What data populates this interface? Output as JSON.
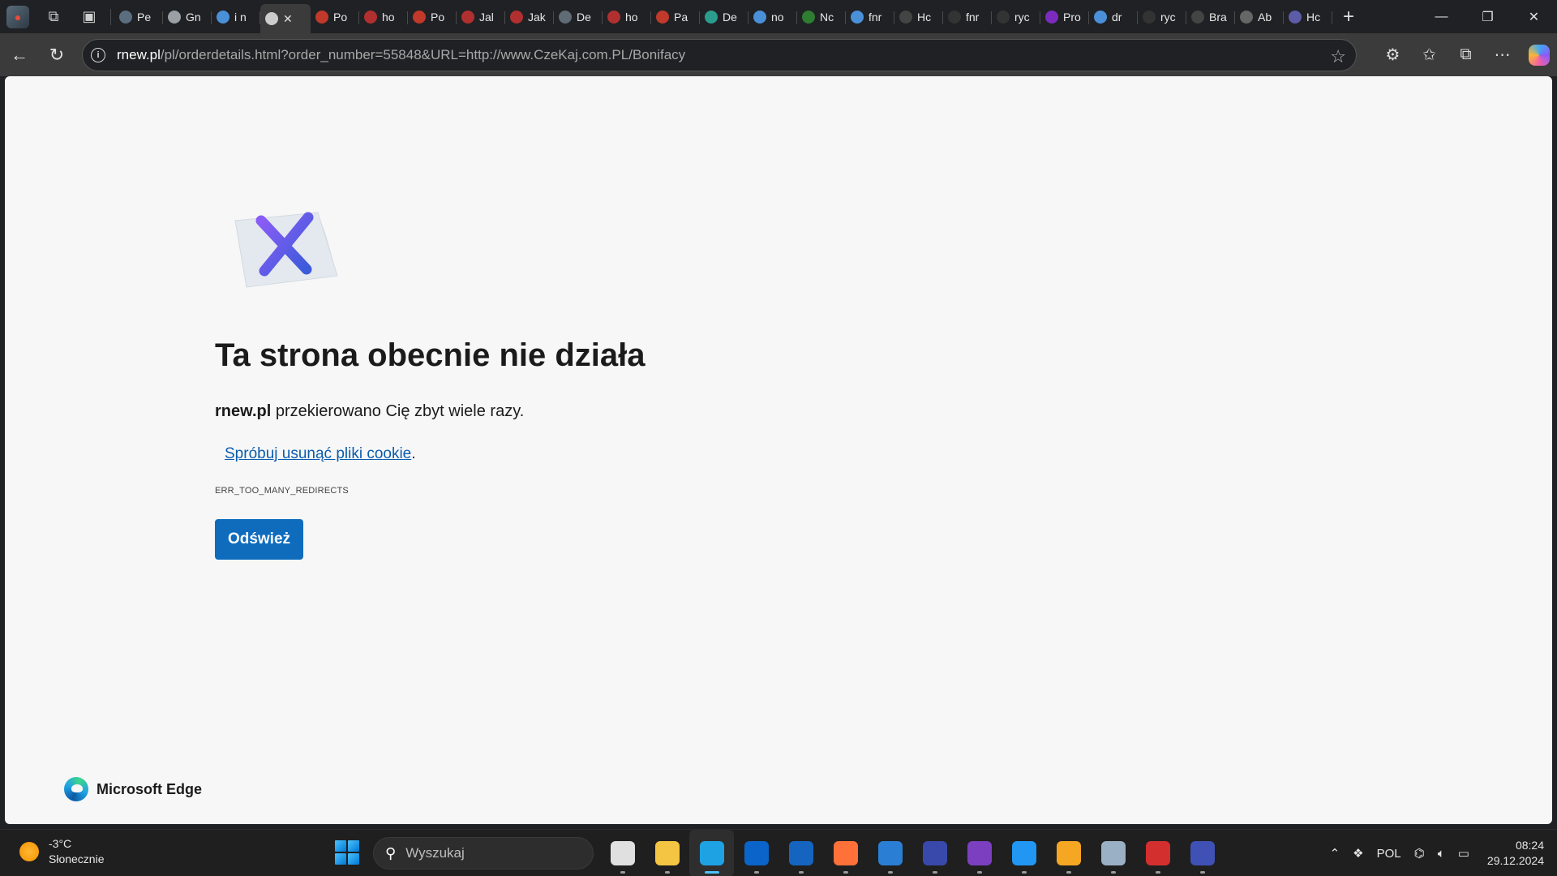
{
  "browser": {
    "tabs": [
      {
        "title": "Pe",
        "color": "#5a6e80"
      },
      {
        "title": "Gn",
        "color": "#9aa0a6"
      },
      {
        "title": "i n",
        "color": "#4a90d9",
        "active": false
      },
      {
        "title": "",
        "color": "#cccccc",
        "active": true
      },
      {
        "title": "Po",
        "color": "#c0392b"
      },
      {
        "title": "ho",
        "color": "#b03030"
      },
      {
        "title": "Po",
        "color": "#c0392b"
      },
      {
        "title": "Jal",
        "color": "#b03030"
      },
      {
        "title": "Jak",
        "color": "#b03030"
      },
      {
        "title": "De",
        "color": "#5f6b75"
      },
      {
        "title": "ho",
        "color": "#b03030"
      },
      {
        "title": "Pa",
        "color": "#c0392b"
      },
      {
        "title": "De",
        "color": "#2a9d8f"
      },
      {
        "title": "no",
        "color": "#4a90d9"
      },
      {
        "title": "Nc",
        "color": "#2e7d32"
      },
      {
        "title": "fnr",
        "color": "#4a90d9"
      },
      {
        "title": "Hc",
        "color": "#444444"
      },
      {
        "title": "fnr",
        "color": "#333333"
      },
      {
        "title": "ryc",
        "color": "#333333"
      },
      {
        "title": "Pro",
        "color": "#7b2cbf"
      },
      {
        "title": "dr",
        "color": "#4a90d9"
      },
      {
        "title": "ryc",
        "color": "#333333"
      },
      {
        "title": "Bra",
        "color": "#444444"
      },
      {
        "title": "Ab",
        "color": "#666666"
      },
      {
        "title": "Hc",
        "color": "#5c5ca8"
      }
    ],
    "url_host": "rnew.pl",
    "url_rest": "/pl/orderdetails.html?order_number=55848&URL=http://www.CzeKaj.com.PL/Bonifacy"
  },
  "page": {
    "title": "Ta strona obecnie nie działa",
    "host": "rnew.pl",
    "description": "przekierowano Cię zbyt wiele razy.",
    "suggestion_link": "Spróbuj usunąć pliki cookie",
    "suggestion_after": ".",
    "error_code": "ERR_TOO_MANY_REDIRECTS",
    "reload_label": "Odśwież",
    "brand": "Microsoft Edge"
  },
  "taskbar": {
    "temperature": "-3°C",
    "weather": "Słonecznie",
    "search_placeholder": "Wyszukaj",
    "language": "POL",
    "time": "08:24",
    "date": "29.12.2024",
    "apps": [
      {
        "name": "task-view",
        "color": "#e0e0e0"
      },
      {
        "name": "file-explorer",
        "color": "#f4c542"
      },
      {
        "name": "edge",
        "color": "#1fa2e4",
        "active": true
      },
      {
        "name": "microsoft-store",
        "color": "#0a64c9"
      },
      {
        "name": "outlook",
        "color": "#1565c0"
      },
      {
        "name": "firefox",
        "color": "#ff7139"
      },
      {
        "name": "photos",
        "color": "#2a7fd4"
      },
      {
        "name": "save-app",
        "color": "#3949ab"
      },
      {
        "name": "podcast-app",
        "color": "#7b3fbf"
      },
      {
        "name": "vscode",
        "color": "#2196f3"
      },
      {
        "name": "media-player",
        "color": "#f5a623"
      },
      {
        "name": "virtualbox",
        "color": "#9ab0c4"
      },
      {
        "name": "pdf-app",
        "color": "#d32f2f"
      },
      {
        "name": "draw-app",
        "color": "#3f51b5"
      }
    ]
  }
}
